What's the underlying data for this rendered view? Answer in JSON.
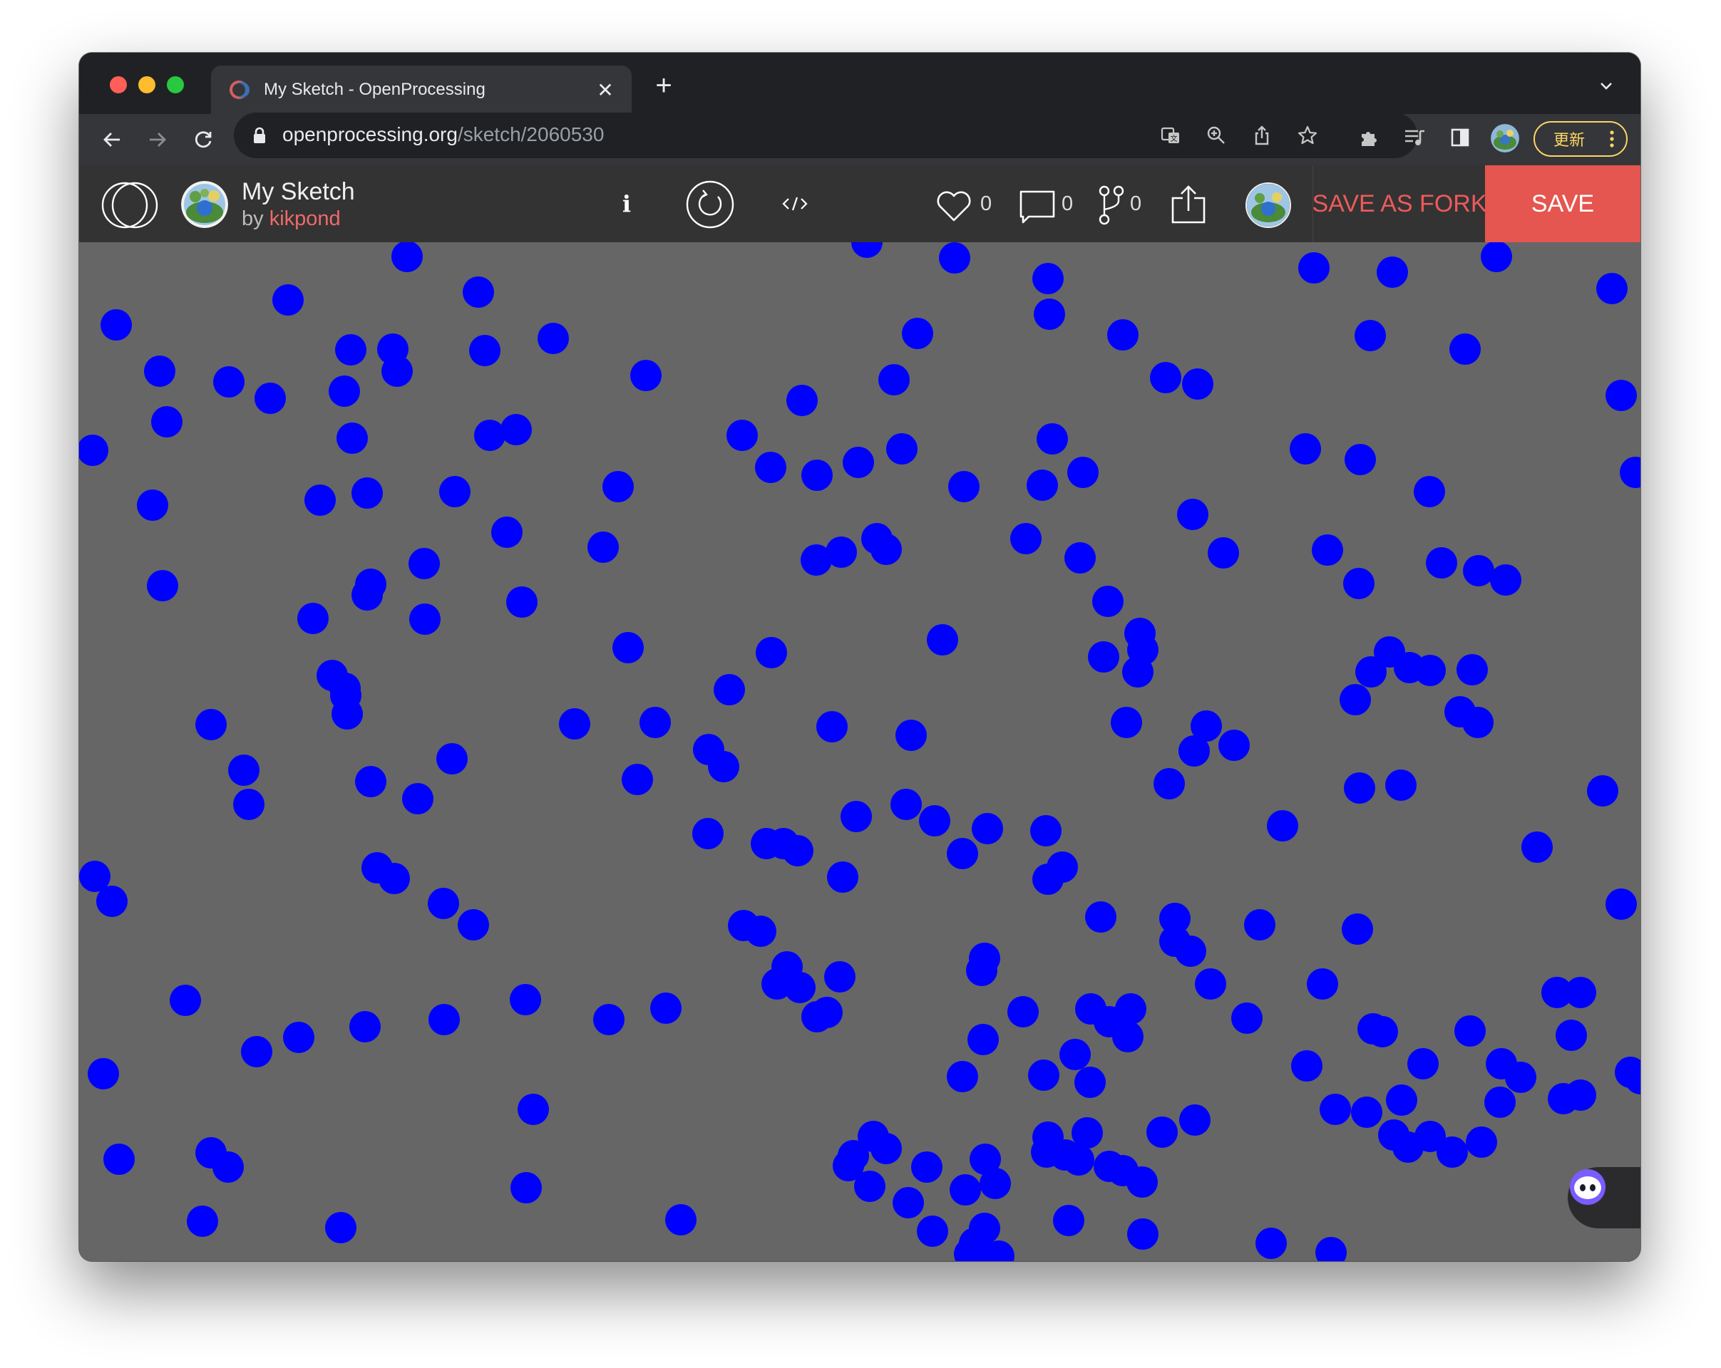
{
  "browser": {
    "tab": {
      "title": "My Sketch - OpenProcessing",
      "close_label": "✕"
    },
    "new_tab_label": "+",
    "url": {
      "host": "openprocessing.org",
      "path": "/sketch/2060530"
    },
    "update_label": "更新"
  },
  "sketch": {
    "title": "My Sketch",
    "by_label": "by",
    "author": "kikpond",
    "info_label": "i",
    "likes": "0",
    "comments": "0",
    "forks": "0",
    "save_as_fork_label": "SAVE AS FORK",
    "save_label": "SAVE"
  },
  "canvas": {
    "background": "#666666",
    "circle_color": "#0000ff"
  }
}
